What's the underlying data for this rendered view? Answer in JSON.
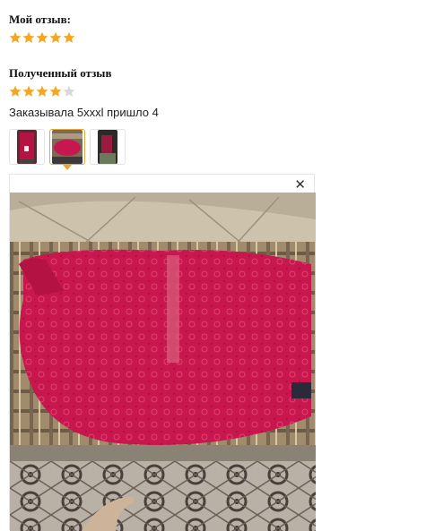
{
  "my_review": {
    "title": "Мой отзыв:",
    "rating": 5,
    "max": 5
  },
  "received_review": {
    "title": "Полученный отзыв",
    "rating": 4,
    "max": 5,
    "text": "Заказывала 5xxxl пришло 4"
  },
  "thumbnails": [
    {
      "name": "photo-1",
      "active": false
    },
    {
      "name": "photo-2",
      "active": true
    },
    {
      "name": "photo-3",
      "active": false
    }
  ],
  "viewer": {
    "close_icon": "close-icon"
  },
  "colors": {
    "star_filled": "#f5a623",
    "star_empty": "#d8d8d8",
    "active_border": "#e5a73a",
    "garment": "#c8174e"
  }
}
